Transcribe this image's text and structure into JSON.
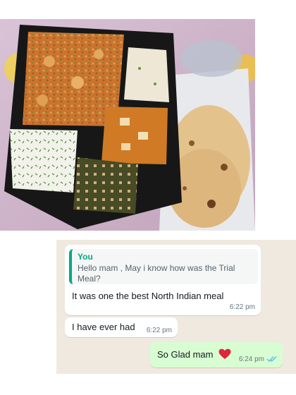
{
  "colors": {
    "chat_background": "#efe9e0",
    "incoming_bubble": "#ffffff",
    "outgoing_bubble": "#d9fdd3",
    "quote_accent": "#06a884",
    "read_ticks": "#53bdeb"
  },
  "photo": {
    "icon": "meal-tray-photo"
  },
  "chat": {
    "messages": [
      {
        "direction": "incoming",
        "quote": {
          "author": "You",
          "text": "Hello mam , May i know how was the Trial Meal?"
        },
        "text": "It was one the best North Indian meal",
        "time": "6:22 pm"
      },
      {
        "direction": "incoming",
        "text": "I have ever had",
        "time": "6:22 pm"
      },
      {
        "direction": "outgoing",
        "text": "So Glad mam",
        "emoji_icon": "red-heart-icon",
        "time": "6:24 pm",
        "status_icon": "double-check-read-icon"
      }
    ]
  }
}
